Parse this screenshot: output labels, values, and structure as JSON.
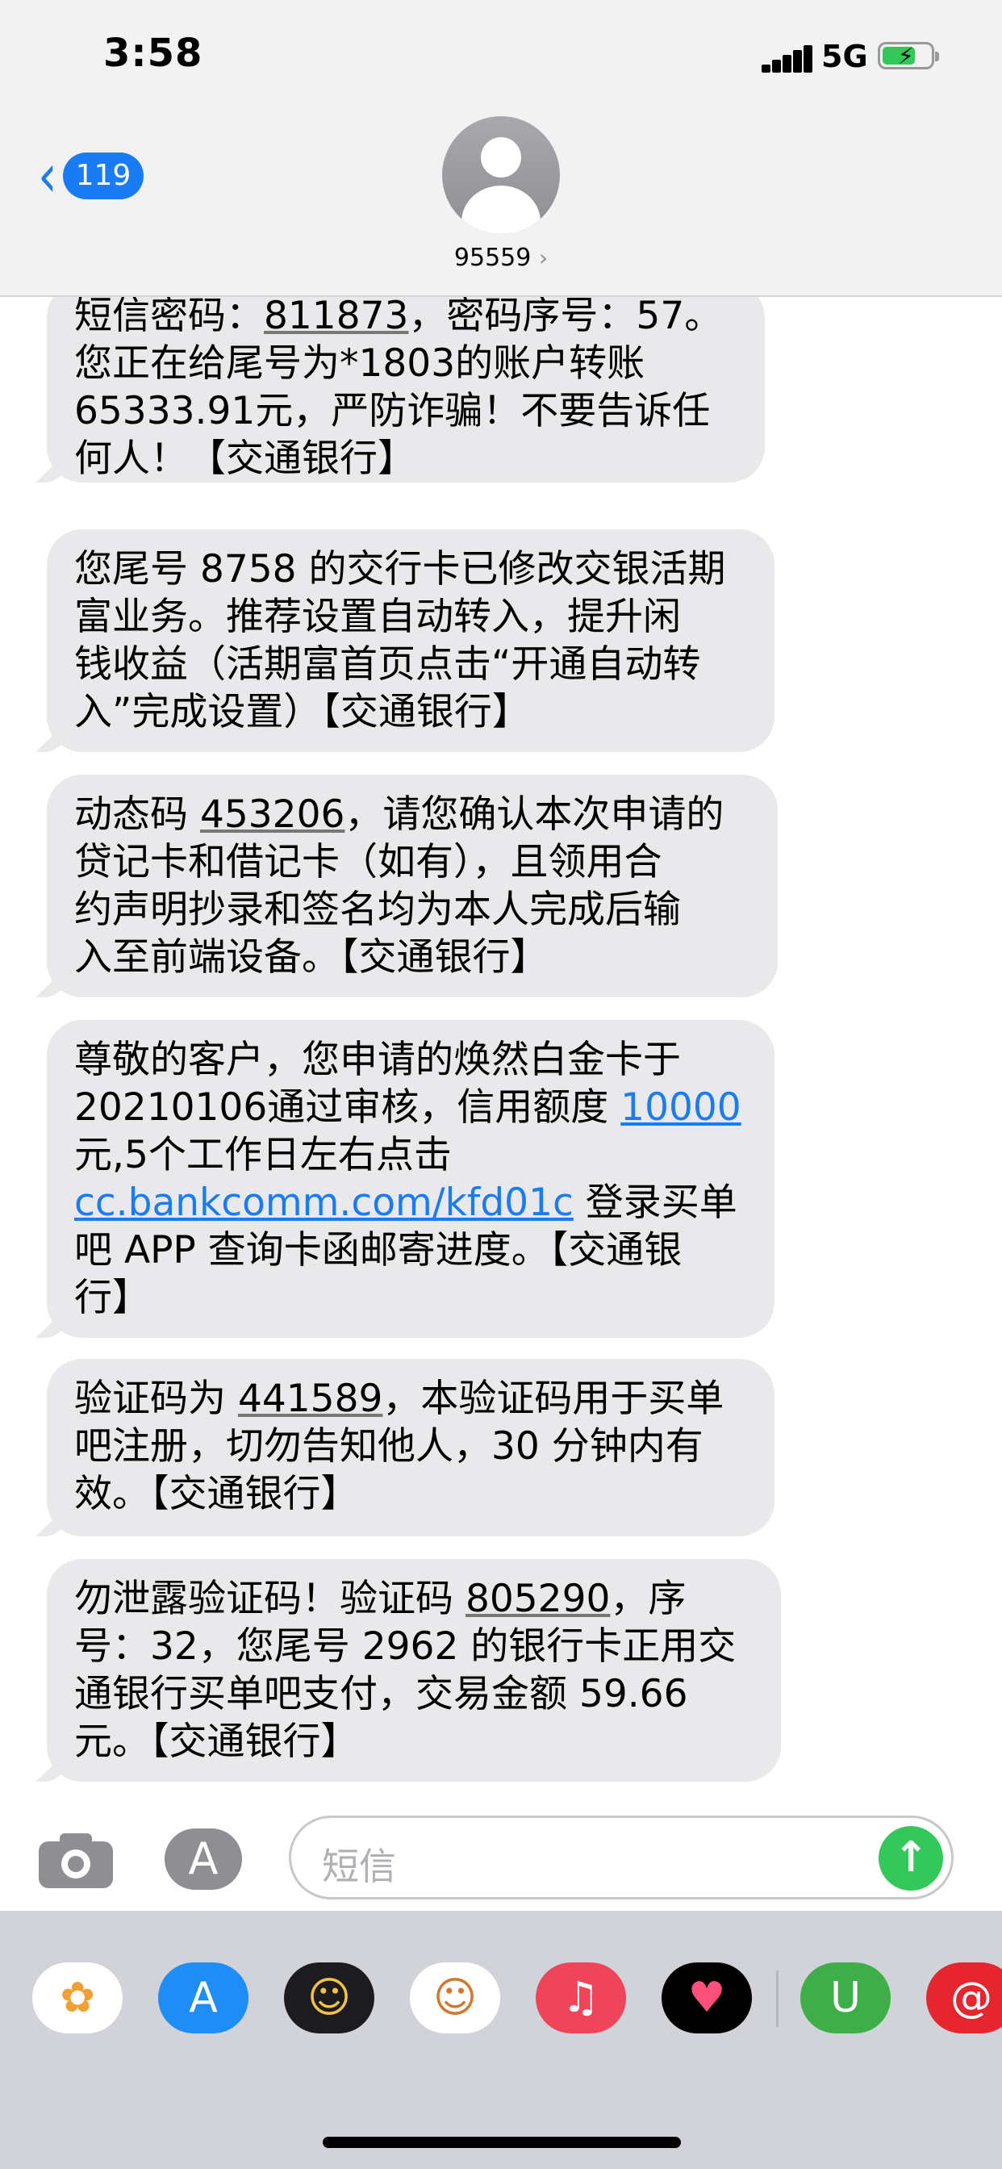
{
  "status_bar": {
    "time": "3:58",
    "network": "5G"
  },
  "header": {
    "back_count": "119",
    "contact": "95559",
    "contact_arrow": "›"
  },
  "messages": [
    {
      "lines": [
        [
          {
            "t": "短信密码："
          },
          {
            "t": "811873",
            "u": true
          },
          {
            "t": "，密码序号：57。"
          }
        ],
        [
          {
            "t": "您正在给尾号为*1803的账户转账"
          }
        ],
        [
          {
            "t": "65333.91元，严防诈骗！不要告诉任"
          }
        ],
        [
          {
            "t": "何人！【交通银行】"
          }
        ]
      ]
    },
    {
      "lines": [
        [
          {
            "t": "您尾号 8758 的交行卡已修改交银活期"
          }
        ],
        [
          {
            "t": "富业务。推荐设置自动转入，提升闲"
          }
        ],
        [
          {
            "t": "钱收益（活期富首页点击“开通自动转"
          }
        ],
        [
          {
            "t": "入”完成设置）【交通银行】"
          }
        ]
      ]
    },
    {
      "lines": [
        [
          {
            "t": "动态码 "
          },
          {
            "t": "453206",
            "u": true
          },
          {
            "t": "，请您确认本次申请的"
          }
        ],
        [
          {
            "t": "贷记卡和借记卡（如有），且领用合"
          }
        ],
        [
          {
            "t": "约声明抄录和签名均为本人完成后输"
          }
        ],
        [
          {
            "t": "入至前端设备。【交通银行】"
          }
        ]
      ]
    },
    {
      "lines": [
        [
          {
            "t": "尊敬的客户，您申请的焕然白金卡于"
          }
        ],
        [
          {
            "t": "20210106通过审核，信用额度 "
          },
          {
            "t": "10000",
            "l": true
          }
        ],
        [
          {
            "t": "元,5个工作日左右点击"
          }
        ],
        [
          {
            "t": "cc.bankcomm.com/kfd01c",
            "l": true
          },
          {
            "t": " 登录买单"
          }
        ],
        [
          {
            "t": "吧 APP 查询卡函邮寄进度。【交通银"
          }
        ],
        [
          {
            "t": "行】"
          }
        ]
      ]
    },
    {
      "lines": [
        [
          {
            "t": "验证码为 "
          },
          {
            "t": "441589",
            "u": true
          },
          {
            "t": "，本验证码用于买单"
          }
        ],
        [
          {
            "t": "吧注册，切勿告知他人，30 分钟内有"
          }
        ],
        [
          {
            "t": "效。【交通银行】"
          }
        ]
      ]
    },
    {
      "lines": [
        [
          {
            "t": "勿泄露验证码！验证码 "
          },
          {
            "t": "805290",
            "u": true
          },
          {
            "t": "，序"
          }
        ],
        [
          {
            "t": "号：32，您尾号 2962 的银行卡正用交"
          }
        ],
        [
          {
            "t": "通银行买单吧支付，交易金额 59.66"
          }
        ],
        [
          {
            "t": "元。【交通银行】"
          }
        ]
      ]
    }
  ],
  "input": {
    "placeholder": "短信",
    "send_icon": "arrow-up-icon"
  },
  "app_drawer": [
    {
      "name": "photos-app-icon",
      "glyph": "✿",
      "bg": "#ffffff",
      "fg": "#f29f33"
    },
    {
      "name": "app-store-app-icon",
      "glyph": "A",
      "bg": "#1e8df5",
      "fg": "#ffffff"
    },
    {
      "name": "memoji-camera-app-icon",
      "glyph": "☺",
      "bg": "#1c1c1e",
      "fg": "#f5c242"
    },
    {
      "name": "memoji-stickers-app-icon",
      "glyph": "☺",
      "bg": "#ffffff",
      "fg": "#d4762c"
    },
    {
      "name": "music-app-icon",
      "glyph": "♫",
      "bg": "#f0445a",
      "fg": "#ffffff"
    },
    {
      "name": "digital-touch-app-icon",
      "glyph": "♥",
      "bg": "#000000",
      "fg": "#ff4f7b"
    },
    {
      "name": "bank-app-icon",
      "glyph": "U",
      "bg": "#3fae49",
      "fg": "#ffffff"
    },
    {
      "name": "netease-music-app-icon",
      "glyph": "@",
      "bg": "#e6262f",
      "fg": "#ffffff"
    }
  ]
}
